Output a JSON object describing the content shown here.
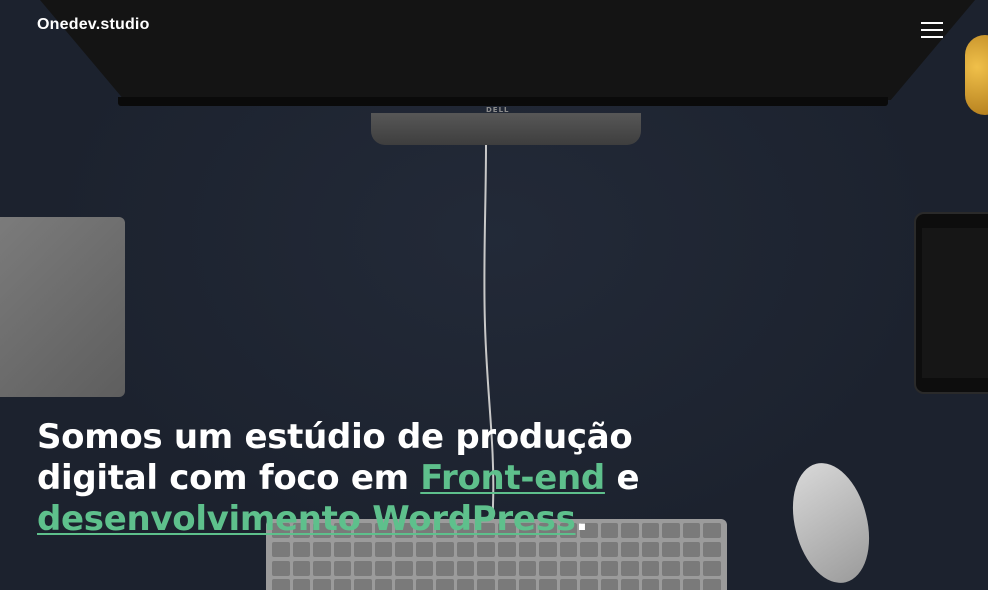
{
  "header": {
    "logo": "Onedev.studio",
    "menu_icon": "hamburger-menu-icon"
  },
  "hero": {
    "line1": "Somos um estúdio de produção",
    "line2_prefix": "digital com foco em ",
    "link1": "Front-end",
    "line2_suffix": " e",
    "link2": "desenvolvimento WordPress",
    "period": "."
  },
  "background": {
    "monitor_brand": "DELL"
  },
  "colors": {
    "background": "#1c222e",
    "accent": "#5ec08c",
    "text": "#ffffff"
  }
}
